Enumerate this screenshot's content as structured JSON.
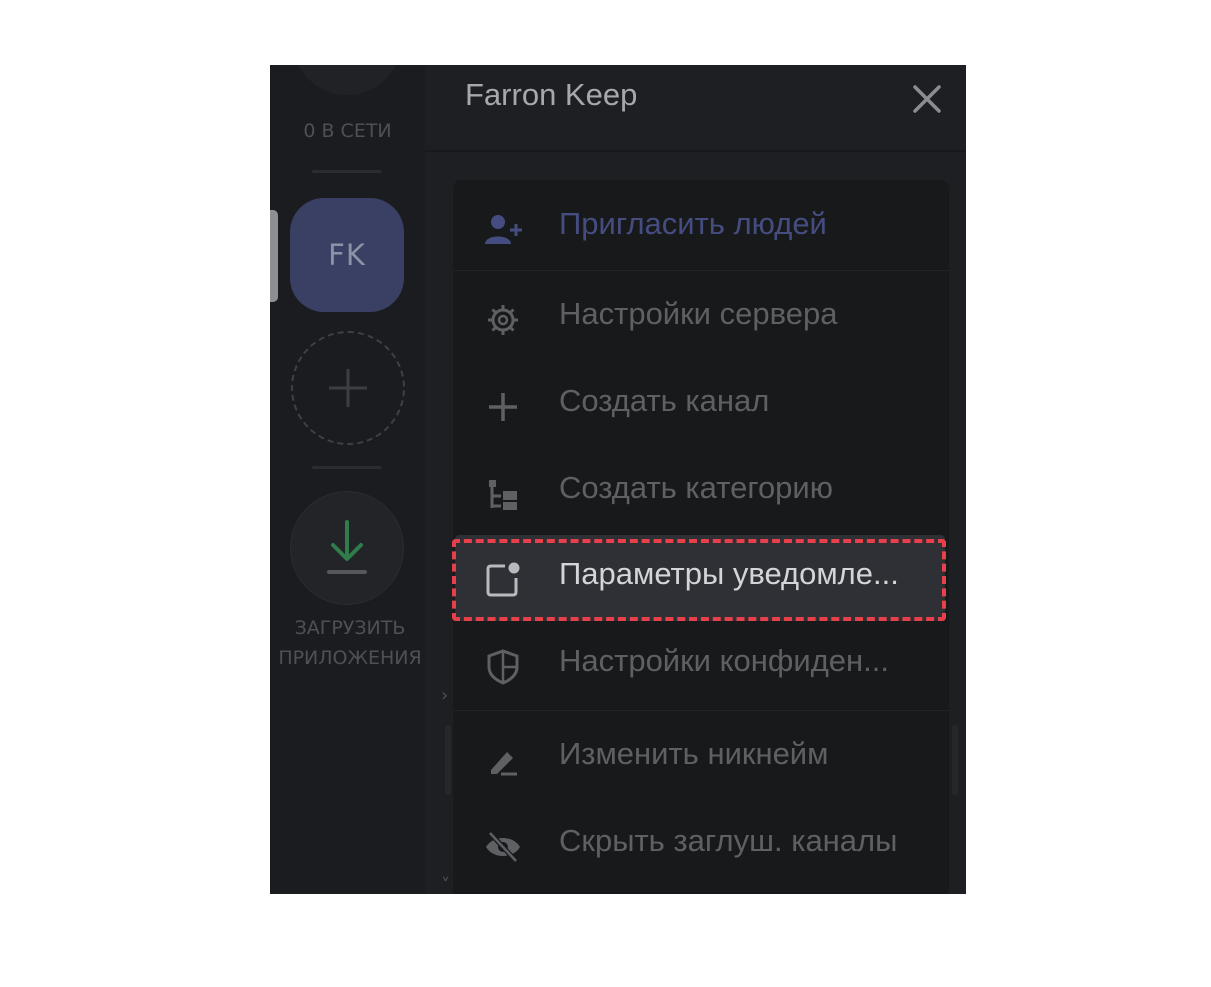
{
  "rail": {
    "online_label": "0 В СЕТИ",
    "server_initials": "FK",
    "download_label_line1": "ЗАГРУЗИТЬ",
    "download_label_line2": "ПРИЛОЖЕНИЯ"
  },
  "header": {
    "server_name": "Farron Keep"
  },
  "menu": {
    "items": [
      {
        "label": "Пригласить людей",
        "icon": "add-person-icon"
      },
      {
        "label": "Настройки сервера",
        "icon": "gear-icon"
      },
      {
        "label": "Создать канал",
        "icon": "plus-icon"
      },
      {
        "label": "Создать категорию",
        "icon": "category-icon"
      },
      {
        "label": "Параметры уведомле...",
        "icon": "notification-icon"
      },
      {
        "label": "Настройки конфиден...",
        "icon": "shield-icon"
      },
      {
        "label": "Изменить никнейм",
        "icon": "pencil-icon"
      },
      {
        "label": "Скрыть заглуш. каналы",
        "icon": "eye-slash-icon"
      }
    ],
    "selected_index": 4
  },
  "colors": {
    "highlight": "#e8404a",
    "invite": "#454d80",
    "download": "#2f7d4a",
    "server_icon": "#3a4063"
  }
}
